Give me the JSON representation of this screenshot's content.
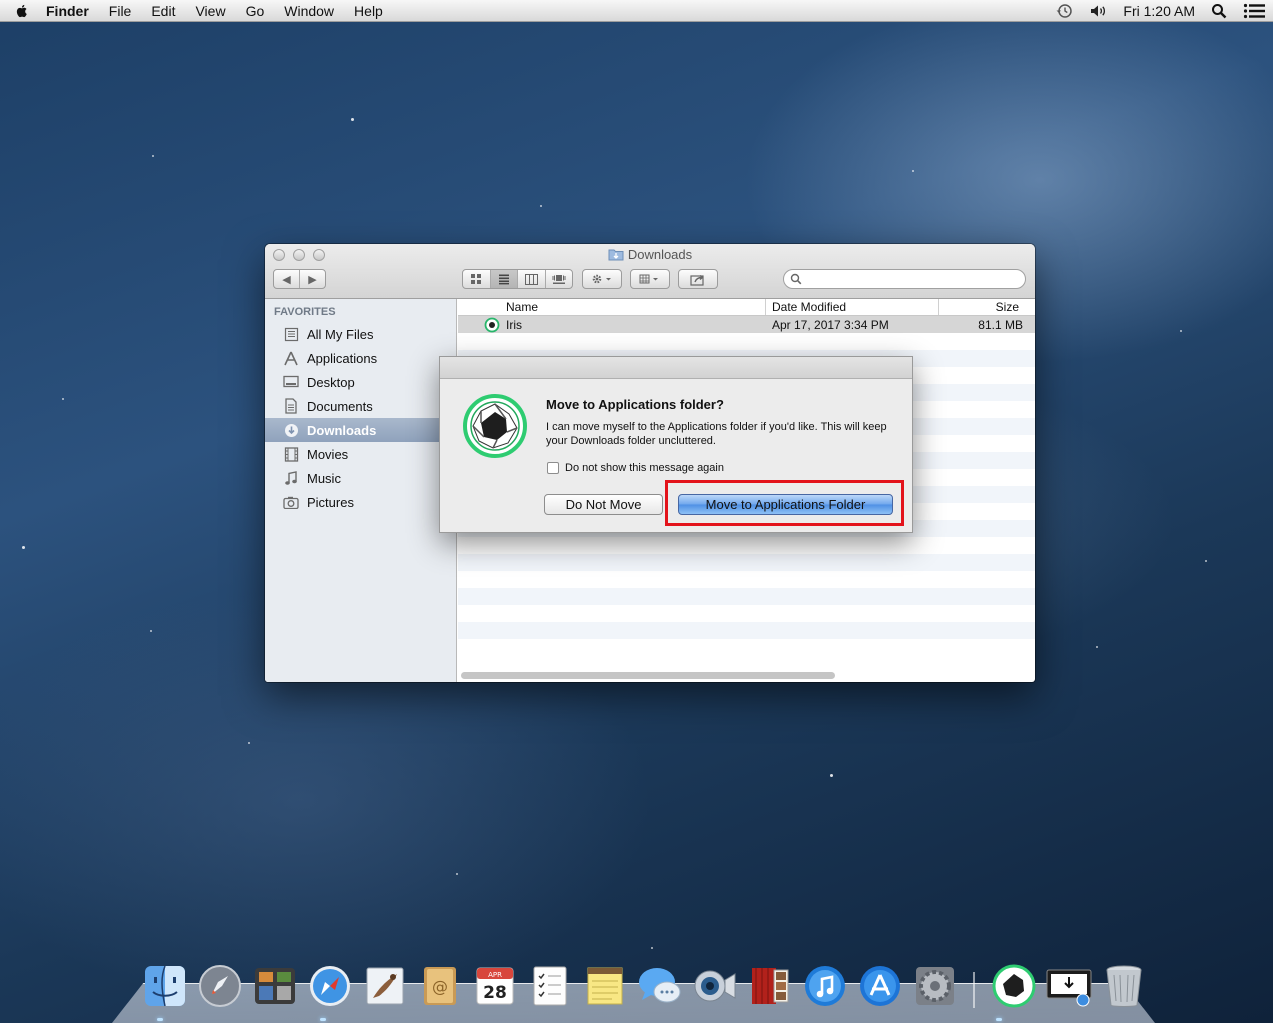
{
  "menubar": {
    "app_name": "Finder",
    "menus": [
      "File",
      "Edit",
      "View",
      "Go",
      "Window",
      "Help"
    ],
    "clock": "Fri 1:20 AM",
    "icons": [
      "apple-icon",
      "time-machine-icon",
      "volume-icon",
      "spotlight-icon",
      "notification-center-icon"
    ]
  },
  "finder": {
    "title": "Downloads",
    "sidebar": {
      "section": "FAVORITES",
      "items": [
        {
          "label": "All My Files",
          "icon": "all-files-icon"
        },
        {
          "label": "Applications",
          "icon": "applications-icon"
        },
        {
          "label": "Desktop",
          "icon": "desktop-icon"
        },
        {
          "label": "Documents",
          "icon": "documents-icon"
        },
        {
          "label": "Downloads",
          "icon": "downloads-icon",
          "selected": true
        },
        {
          "label": "Movies",
          "icon": "movies-icon"
        },
        {
          "label": "Music",
          "icon": "music-icon"
        },
        {
          "label": "Pictures",
          "icon": "pictures-icon"
        }
      ]
    },
    "columns": {
      "name": "Name",
      "date": "Date Modified",
      "size": "Size"
    },
    "files": [
      {
        "name": "Iris",
        "date": "Apr 17, 2017 3:34 PM",
        "size": "81.1 MB"
      }
    ],
    "search": {
      "placeholder": ""
    }
  },
  "dialog": {
    "title": "Move to Applications folder?",
    "message": "I can move myself to the Applications folder if you'd like. This will keep your Downloads folder uncluttered.",
    "checkbox_label": "Do not show this message again",
    "checkbox_checked": false,
    "cancel_label": "Do Not Move",
    "confirm_label": "Move to Applications Folder"
  },
  "dock": {
    "apps": [
      "Finder",
      "Launchpad",
      "Mission Control",
      "Safari",
      "Mail",
      "Contacts",
      "Calendar",
      "Reminders",
      "Notes",
      "Messages",
      "FaceTime",
      "Photo Booth",
      "iTunes",
      "App Store",
      "System Preferences",
      "Iris",
      "Downloads",
      "Trash"
    ],
    "calendar_month": "APR",
    "calendar_day": "28"
  },
  "colors": {
    "accent": "#4e8fe4",
    "highlight": "#e3131b",
    "iris_green": "#2ecc71"
  }
}
